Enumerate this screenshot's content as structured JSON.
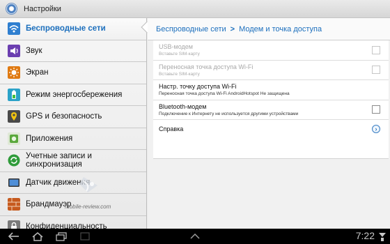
{
  "app": {
    "title": "Настройки"
  },
  "sidebar": {
    "items": [
      {
        "label": "Беспроводные сети",
        "icon": "wifi-icon",
        "selected": true
      },
      {
        "label": "Звук",
        "icon": "speaker-icon"
      },
      {
        "label": "Экран",
        "icon": "brightness-icon"
      },
      {
        "label": "Режим энергосбережения",
        "icon": "battery-icon"
      },
      {
        "label": "GPS и безопасность",
        "icon": "gps-icon"
      },
      {
        "label": "Приложения",
        "icon": "apps-icon"
      },
      {
        "label": "Учетные записи и синхронизация",
        "icon": "sync-icon"
      },
      {
        "label": "Датчик движения",
        "icon": "tablet-icon"
      },
      {
        "label": "Брандмауэр",
        "icon": "firewall-icon"
      },
      {
        "label": "Конфиденциальность",
        "icon": "privacy-icon"
      }
    ]
  },
  "breadcrumb": {
    "parent": "Беспроводные сети",
    "separator": ">",
    "current": "Модем и точка доступа"
  },
  "settings": [
    {
      "title": "USB-модем",
      "subtitle": "Вставьте SIM-карту",
      "enabled": false,
      "control": "checkbox"
    },
    {
      "title": "Переносная точка доступа Wi-Fi",
      "subtitle": "Вставьте SIM-карту",
      "enabled": false,
      "control": "checkbox"
    },
    {
      "title": "Настр. точку доступа Wi-Fi",
      "subtitle": "Переносная точка доступа Wi-Fi AndroidHotspot Не защищена",
      "enabled": true,
      "control": "none"
    },
    {
      "title": "Bluetooth-модем",
      "subtitle": "Подключение к Интернету не используется другими устройствами",
      "enabled": true,
      "control": "checkbox"
    }
  ],
  "help": {
    "title": "Справка",
    "icon": "chevron-right-icon"
  },
  "navbar": {
    "time": "7:22"
  },
  "watermark": {
    "text": "mobile-review.com"
  },
  "colors": {
    "accent": "#1c6fbd",
    "sidebar_bg": "#eeeeee",
    "navbar_bg": "#000000"
  }
}
